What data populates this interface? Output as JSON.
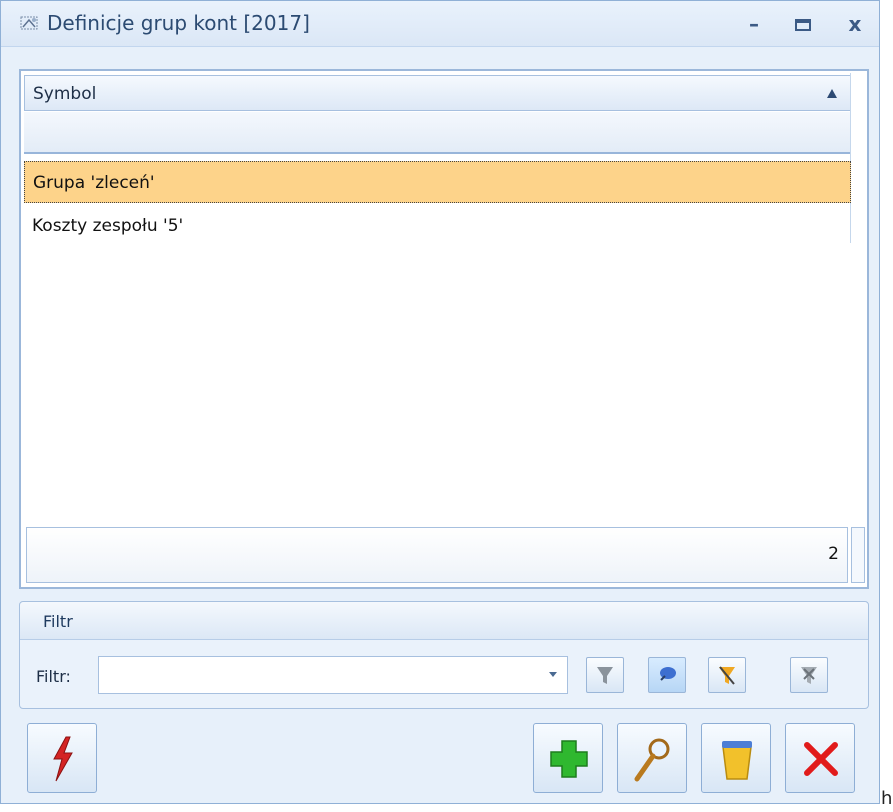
{
  "window": {
    "title": "Definicje grup kont [2017]"
  },
  "titlebar": {
    "minimize": "–",
    "maximize": "▭",
    "close": "x"
  },
  "grid": {
    "column_header": "Symbol",
    "rows": [
      {
        "label": "Grupa 'zleceń'",
        "selected": true
      },
      {
        "label": "Koszty zespołu '5'",
        "selected": false
      }
    ],
    "record_count": "2"
  },
  "filter_group": {
    "title": "Filtr",
    "label": "Filtr:",
    "value": ""
  },
  "stray_text": "h"
}
